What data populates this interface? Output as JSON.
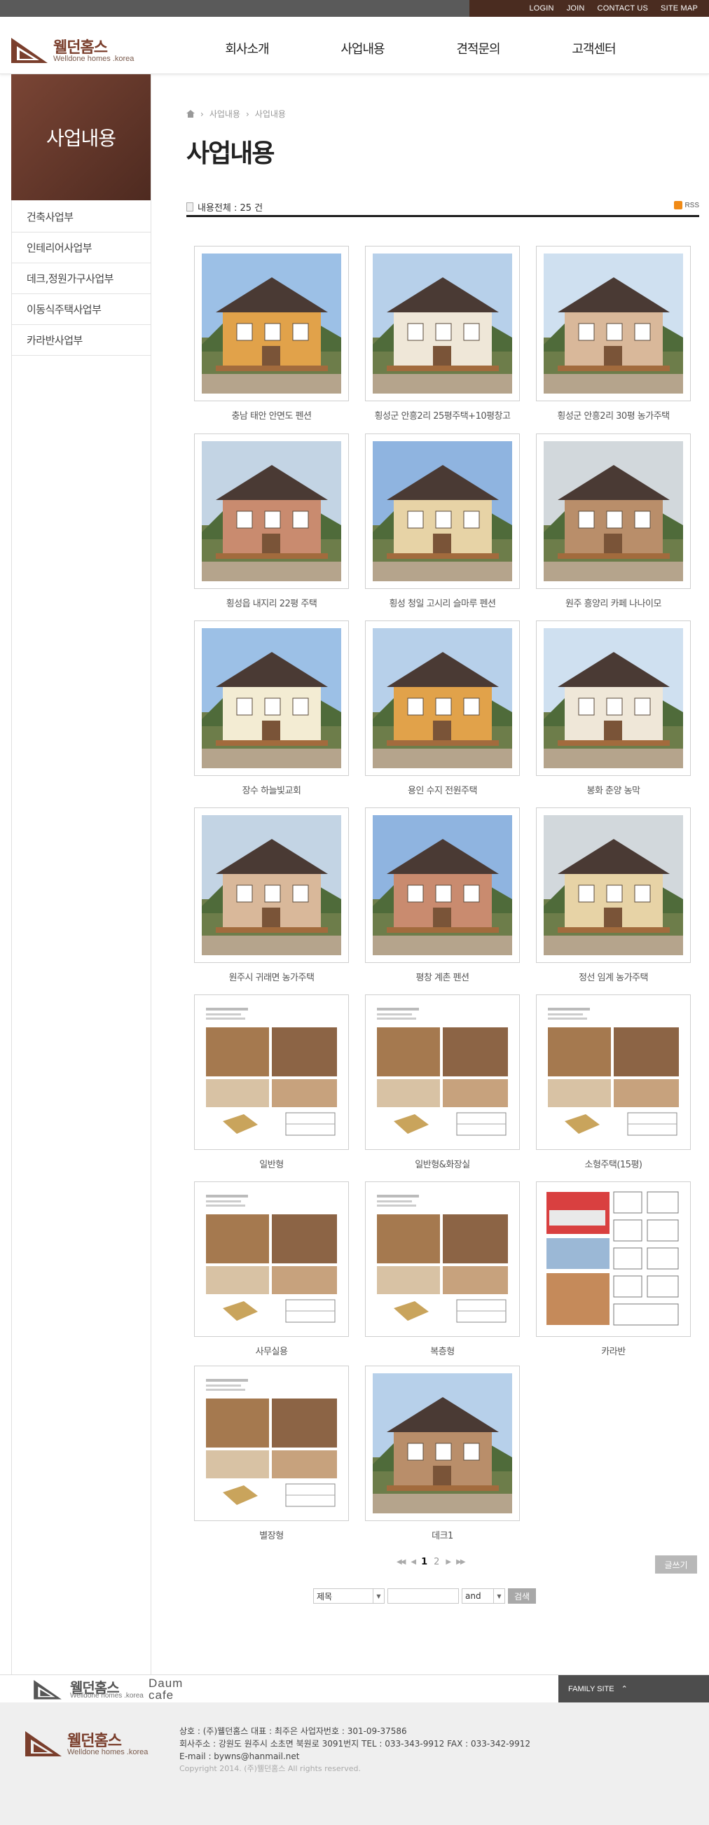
{
  "util_nav": [
    "LOGIN",
    "JOIN",
    "CONTACT US",
    "SITE MAP"
  ],
  "brand": {
    "name": "웰던홈스",
    "sub": "Welldone homes .korea",
    "color": "#7a3e2c"
  },
  "gnb": [
    "회사소개",
    "사업내용",
    "견적문의",
    "고객센터"
  ],
  "sidebar": {
    "title": "사업내용",
    "items": [
      "건축사업부",
      "인테리어사업부",
      "데크,정원가구사업부",
      "이동식주택사업부",
      "카라반사업부"
    ]
  },
  "breadcrumb": [
    "사업내용",
    "사업내용"
  ],
  "page_title": "사업내용",
  "count_label": "내용전체 : 25 건",
  "rss_label": "RSS",
  "gallery": [
    "충남 태안 안면도 펜션",
    "횡성군 안흥2리 25평주택+10평창고",
    "횡성군 안흥2리 30평 농가주택",
    "횡성읍 내지리 22평 주택",
    "횡성 청일 고시리 슬마루 펜션",
    "원주 흥양리 카페 나나이모",
    "장수 하늘빛교회",
    "용인 수지 전원주택",
    "봉화 춘양 농막",
    "원주시 귀래면 농가주택",
    "평창 계촌 펜션",
    "정선 임계 농가주택",
    "일반형",
    "일반형&화장실",
    "소형주택(15평)",
    "사무실용",
    "복층형",
    "카라반",
    "별장형",
    "데크1"
  ],
  "pagination": {
    "pages": [
      "1",
      "2"
    ],
    "current": "1"
  },
  "write_button": "글쓰기",
  "search": {
    "field": "제목",
    "operator": "and",
    "button": "검색",
    "value": ""
  },
  "footer": {
    "daum_label": "Daum\ncafe",
    "family_site": "FAMILY SITE",
    "line1": "상호 : (주)웰던홈스    대표 : 최주은    사업자번호 : 301-09-37586",
    "line2": "회사주소 : 강원도 원주시 소초면 북원로 3091번지    TEL : 033-343-9912    FAX : 033-342-9912",
    "line3": "E-mail : bywns@hanmail.net",
    "copyright": "Copyright 2014. (주)웰던홈스 All rights reserved."
  }
}
